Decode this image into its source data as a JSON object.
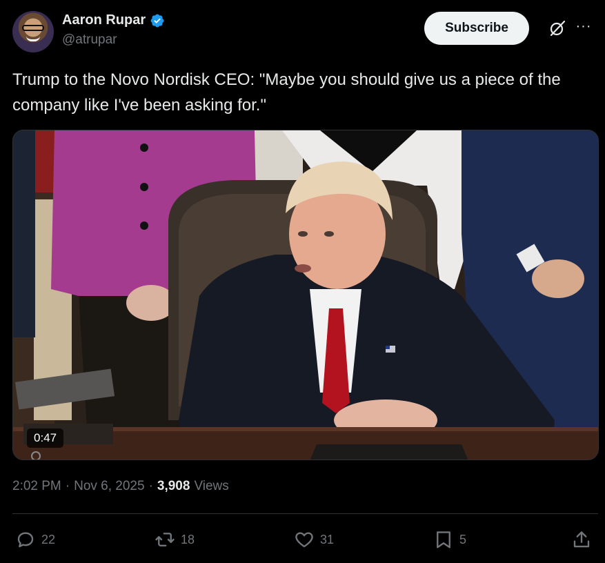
{
  "author": {
    "display_name": "Aaron Rupar",
    "handle": "@atrupar",
    "verified": true
  },
  "header": {
    "subscribe_label": "Subscribe"
  },
  "tweet": {
    "text": "Trump to the Novo Nordisk CEO: \"Maybe you should give us a piece of the company like I've been asking for.\""
  },
  "media": {
    "type": "video",
    "duration": "0:47"
  },
  "meta": {
    "time": "2:02 PM",
    "separator": "·",
    "date": "Nov 6, 2025",
    "views_count": "3,908",
    "views_label": "Views"
  },
  "actions": {
    "replies": "22",
    "reposts": "18",
    "likes": "31",
    "bookmarks": "5"
  },
  "colors": {
    "background": "#000000",
    "text_primary": "#e7e9ea",
    "text_secondary": "#71767b",
    "verified_blue": "#1d9bf0",
    "divider": "#2f3336"
  },
  "icons": [
    "verified-badge-icon",
    "grok-icon",
    "more-icon",
    "reply-icon",
    "repost-icon",
    "like-icon",
    "bookmark-icon",
    "share-icon"
  ]
}
